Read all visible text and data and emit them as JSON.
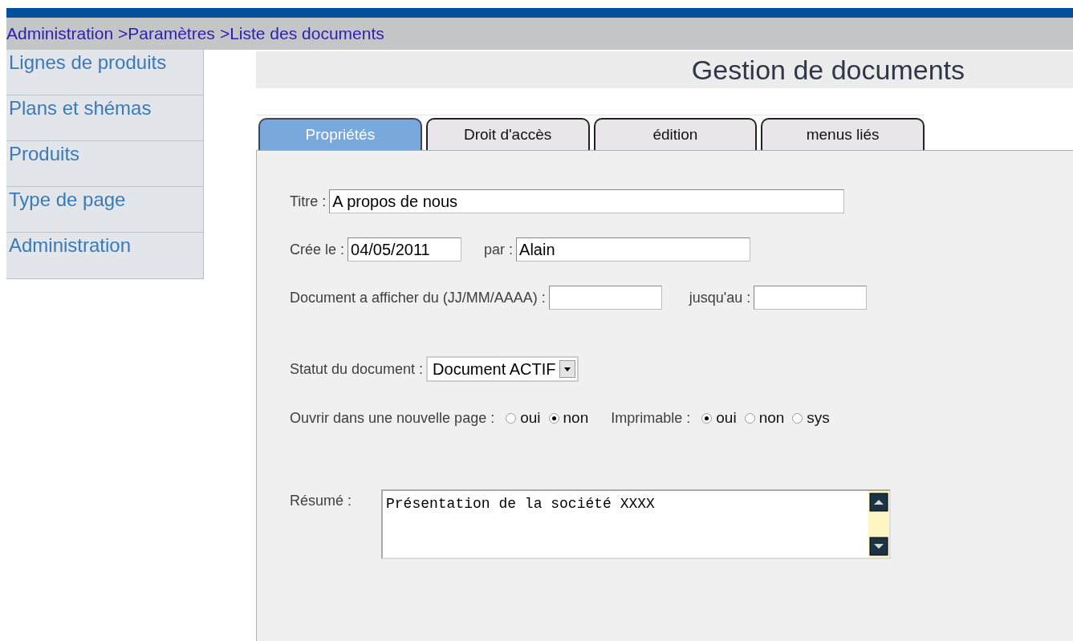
{
  "breadcrumb": [
    "Administration",
    ">Paramètres",
    ">Liste des documents"
  ],
  "sidebar": {
    "items": [
      {
        "label": "Lignes de produits"
      },
      {
        "label": "Plans et shémas"
      },
      {
        "label": "Produits"
      },
      {
        "label": "Type de page"
      },
      {
        "label": "Administration"
      }
    ]
  },
  "page_title": "Gestion de documents",
  "tabs": [
    {
      "label": "Propriétés",
      "selected": true
    },
    {
      "label": "Droit d'accès",
      "selected": false
    },
    {
      "label": "édition",
      "selected": false
    },
    {
      "label": "menus liés",
      "selected": false
    }
  ],
  "form": {
    "title": {
      "label": "Titre :",
      "value": "A propos de nous"
    },
    "created": {
      "label": "Crée le :",
      "value": "04/05/2011"
    },
    "by": {
      "label": "par :",
      "value": "Alain"
    },
    "display_from": {
      "label": "Document a afficher du (JJ/MM/AAAA) :"
    },
    "display_until": {
      "label": "jusqu'au :"
    },
    "status": {
      "label": "Statut du document :",
      "value": "Document ACTIF"
    },
    "radio_groups": [
      {
        "label": "Ouvrir dans une nouvelle page :",
        "options": [
          {
            "label": "oui",
            "selected": false
          },
          {
            "label": "non",
            "selected": true
          }
        ]
      },
      {
        "label": "Imprimable :",
        "options": [
          {
            "label": "oui",
            "selected": true
          },
          {
            "label": "non",
            "selected": false
          },
          {
            "label": "sys",
            "selected": false
          }
        ]
      }
    ],
    "summary": {
      "label": "Résumé :",
      "value": "Présentation de la société XXXX"
    }
  }
}
